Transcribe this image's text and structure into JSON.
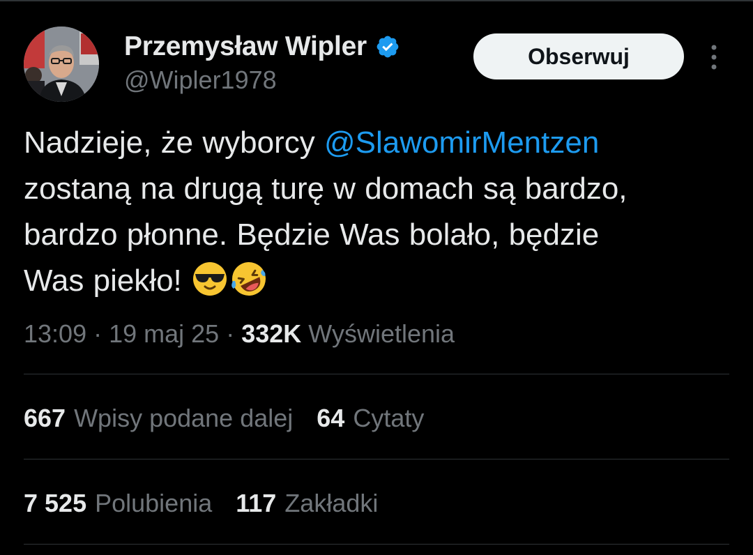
{
  "author": {
    "display_name": "Przemysław Wipler",
    "handle": "@Wipler1978",
    "verified": true,
    "verified_icon": "verified-badge-icon",
    "verified_color": "#1d9bf0"
  },
  "follow_label": "Obserwuj",
  "more_icon": "more-vertical-icon",
  "tweet": {
    "text_before": "Nadzieje, że wyborcy ",
    "mention": "@SlawomirMentzen",
    "text_after": "\nzostaną na drugą turę w domach są bardzo,\nbardzo płonne. Będzie Was bolało, będzie\nWas piekło! ",
    "emojis": [
      "smiling-face-with-sunglasses",
      "rolling-on-the-floor-laughing"
    ]
  },
  "meta": {
    "time": "13:09",
    "separator": " · ",
    "date": "19 maj 25",
    "views_count": "332K",
    "views_label": "Wyświetlenia"
  },
  "stats": {
    "reposts_count": "667",
    "reposts_label": "Wpisy podane dalej",
    "quotes_count": "64",
    "quotes_label": "Cytaty",
    "likes_count": "7 525",
    "likes_label": "Polubienia",
    "bookmarks_count": "117",
    "bookmarks_label": "Zakładki"
  },
  "colors": {
    "background": "#000000",
    "text": "#e7e9ea",
    "secondary_text": "#71767b",
    "link": "#1d9bf0",
    "divider": "#2f3336",
    "button_bg": "#eff3f4"
  }
}
